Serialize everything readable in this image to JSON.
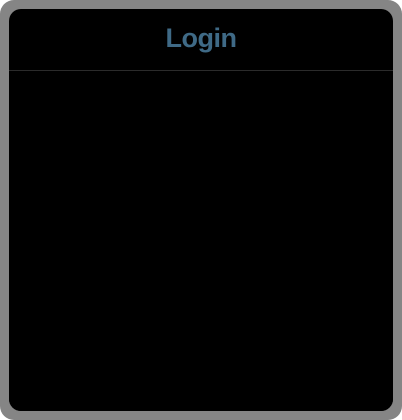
{
  "dialog": {
    "title": "Login",
    "title_color": "#3f6a86",
    "frame_color": "#858585",
    "panel_color": "#000000"
  }
}
